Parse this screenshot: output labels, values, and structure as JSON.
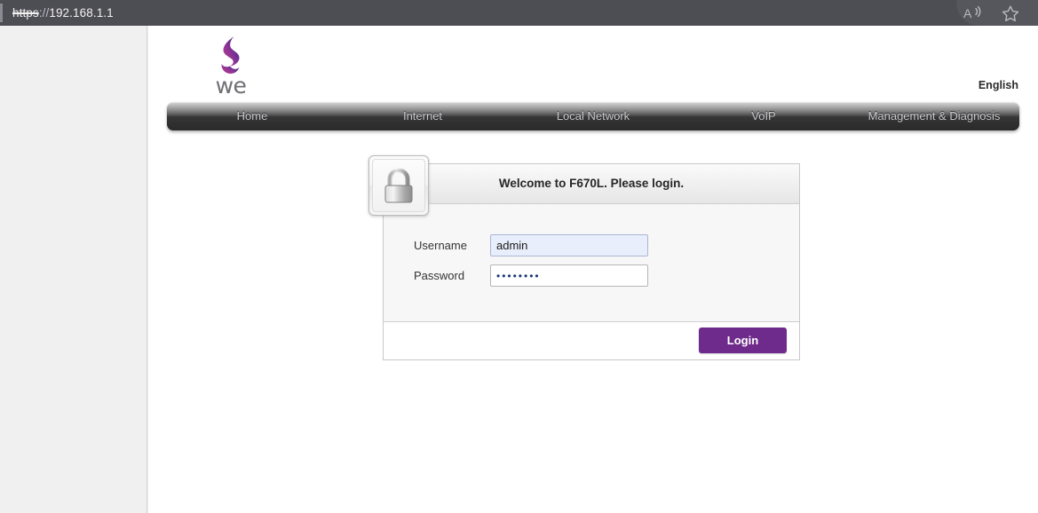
{
  "browser": {
    "url_scheme": "https",
    "url_separator": "://",
    "url_host": "192.168.1.1",
    "url_full": "https://192.168.1.1",
    "read_aloud_icon": "read-aloud-icon",
    "favorites_icon": "star-outline-icon",
    "chrome_bg": "#4d4d54"
  },
  "brand": {
    "logo_icon": "we-flame-logo-icon",
    "wordmark": "we",
    "accent_color": "#6e2b8b"
  },
  "header": {
    "language": "English"
  },
  "nav": {
    "items": [
      {
        "label": "Home"
      },
      {
        "label": "Internet"
      },
      {
        "label": "Local Network"
      },
      {
        "label": "VoIP"
      },
      {
        "label": "Management & Diagnosis"
      }
    ]
  },
  "login": {
    "lock_icon": "padlock-closed-icon",
    "title": "Welcome to F670L. Please login.",
    "username_label": "Username",
    "username_value": "admin",
    "username_placeholder": "",
    "password_label": "Password",
    "password_value": "••••••••",
    "password_placeholder": "",
    "submit_label": "Login",
    "submit_color": "#6e2b8b"
  }
}
